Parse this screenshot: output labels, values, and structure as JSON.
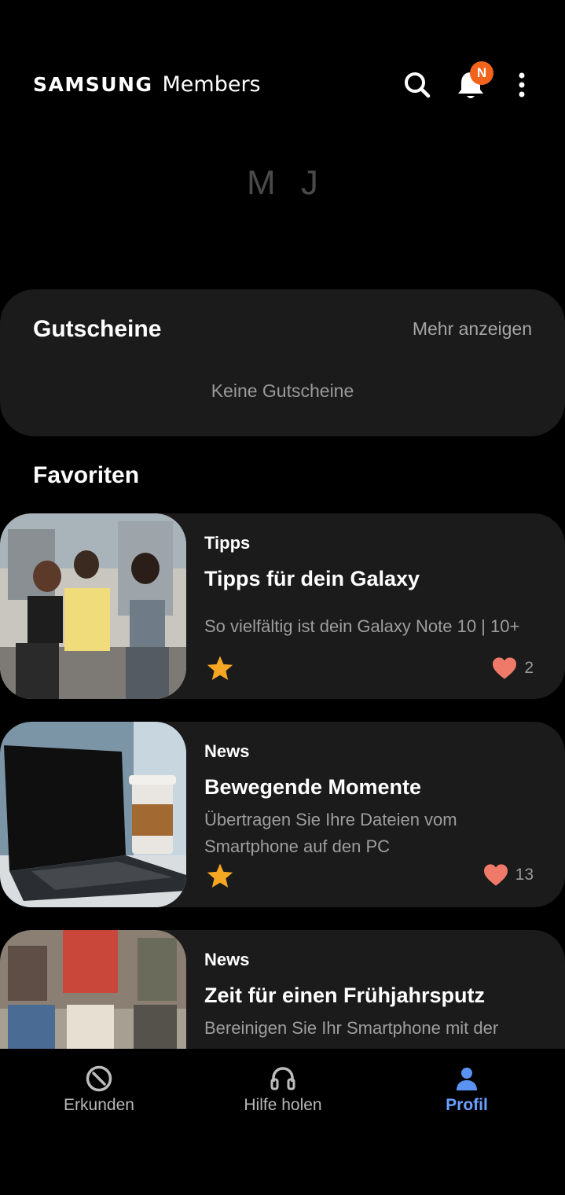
{
  "header": {
    "brand_samsung": "SAMSUNG",
    "brand_members": "Members",
    "notification_badge": "N",
    "icons": [
      "search-icon",
      "bell-icon",
      "more-vert-icon"
    ]
  },
  "profile": {
    "initials": "M J"
  },
  "vouchers": {
    "title": "Gutscheine",
    "more_label": "Mehr anzeigen",
    "empty_text": "Keine Gutscheine"
  },
  "favorites": {
    "title": "Favoriten",
    "items": [
      {
        "category": "Tipps",
        "title": "Tipps für dein Galaxy",
        "description": "So vielfältig ist dein Galaxy Note 10 | 10+",
        "likes": "2"
      },
      {
        "category": "News",
        "title": "Bewegende Momente",
        "description": "Übertragen Sie Ihre Dateien vom Smartphone auf den PC",
        "likes": "13"
      },
      {
        "category": "News",
        "title": "Zeit für einen Frühjahrsputz",
        "description": "Bereinigen Sie Ihr Smartphone mit der"
      }
    ]
  },
  "bottom_nav": {
    "items": [
      {
        "label": "Erkunden",
        "icon": "compass-icon"
      },
      {
        "label": "Hilfe holen",
        "icon": "headset-icon"
      },
      {
        "label": "Profil",
        "icon": "person-icon",
        "active": true
      }
    ]
  },
  "colors": {
    "background": "#000000",
    "card": "#1b1b1b",
    "badge": "#f2641c",
    "star": "#f5a623",
    "heart": "#f07a6a",
    "active_nav": "#6aa0ff"
  }
}
